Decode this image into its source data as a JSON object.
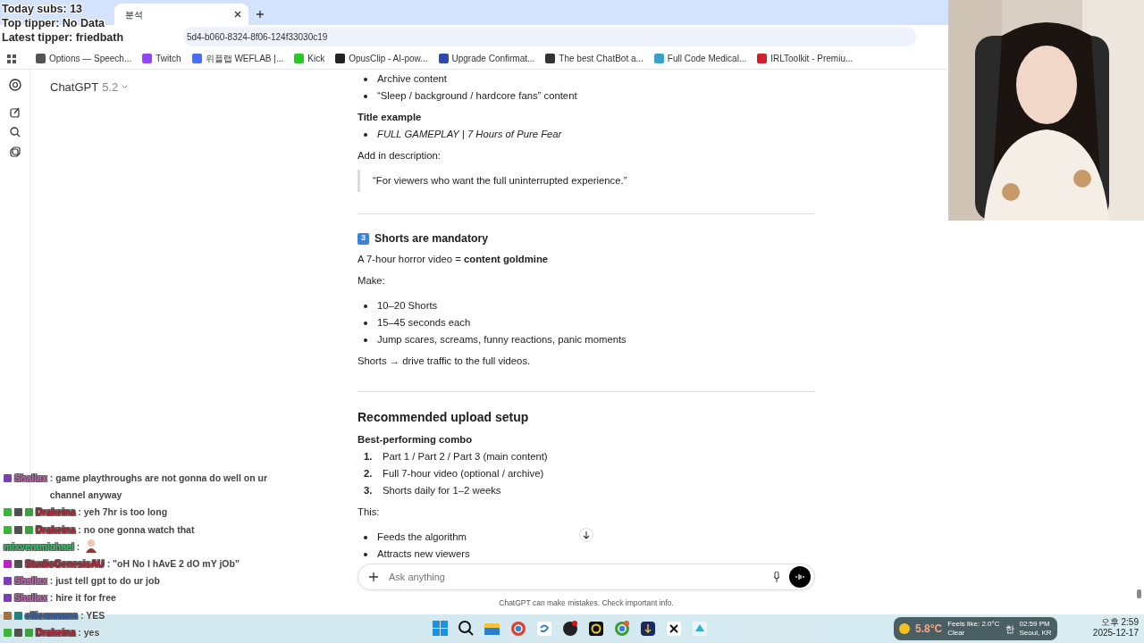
{
  "stream_stats": [
    "Today subs: 13",
    "Top tipper: No Data",
    "Latest tipper: friedbath"
  ],
  "browser": {
    "tab": {
      "title": "분석"
    },
    "url": "5d4-b060-8324-8f06-124f33030c19",
    "bookmarks": [
      {
        "label": "Options — Speech...",
        "color": "#555555"
      },
      {
        "label": "Twitch",
        "color": "#9146ff"
      },
      {
        "label": "위플랩 WEFLAB |...",
        "color": "#4a6cf7"
      },
      {
        "label": "Kick",
        "color": "#28c828"
      },
      {
        "label": "OpusClip - AI-pow...",
        "color": "#222222"
      },
      {
        "label": "Upgrade Confirmat...",
        "color": "#2a4ab0"
      },
      {
        "label": "The best ChatBot a...",
        "color": "#333333"
      },
      {
        "label": "Full Code Medical...",
        "color": "#3aa0c8"
      },
      {
        "label": "IRLToolkit - Premiu...",
        "color": "#d0202a"
      }
    ]
  },
  "header": {
    "model": "ChatGPT",
    "version": "5.2"
  },
  "content": [
    {
      "kind": "bullets",
      "items": [
        "Archive content",
        "“Sleep / background / hardcore fans” content"
      ]
    },
    {
      "kind": "label",
      "text": "Title example"
    },
    {
      "kind": "bullets",
      "italic": true,
      "items": [
        "FULL GAMEPLAY | 7 Hours of Pure Fear"
      ]
    },
    {
      "kind": "text",
      "text": "Add in description:"
    },
    {
      "kind": "quote",
      "text": "“For viewers who want the full uninterrupted experience.”"
    },
    {
      "kind": "divider"
    },
    {
      "kind": "heading3",
      "number": "3",
      "text": "Shorts are mandatory"
    },
    {
      "kind": "text",
      "text": "A 7-hour horror video = **content goldmine**"
    },
    {
      "kind": "text",
      "text": "Make:"
    },
    {
      "kind": "bullets",
      "items": [
        "10–20 Shorts",
        "15–45 seconds each",
        "Jump scares, screams, funny reactions, panic moments"
      ]
    },
    {
      "kind": "text",
      "text": "Shorts → drive traffic to the full videos."
    },
    {
      "kind": "divider"
    },
    {
      "kind": "heading2",
      "text": "Recommended upload setup"
    },
    {
      "kind": "label",
      "text": "Best-performing combo"
    },
    {
      "kind": "numbered",
      "items": [
        {
          "number": "1.",
          "text": "Part 1 / Part 2 / Part 3 (main content)"
        },
        {
          "number": "2.",
          "text": "Full 7-hour video (optional / archive)"
        },
        {
          "number": "3.",
          "text": "Shorts daily for 1–2 weeks"
        }
      ]
    },
    {
      "kind": "text",
      "text": "This:"
    },
    {
      "kind": "bullets",
      "items": [
        "Feeds the algorithm",
        "Attracts new viewers"
      ]
    }
  ],
  "composer": {
    "placeholder": "Ask anything"
  },
  "disclaimer": "ChatGPT can make mistakes. Check important info.",
  "chat": [
    {
      "user": "Shallax",
      "color": "#c060b0",
      "badges": [
        {
          "color": "#7a3fb0"
        }
      ],
      "text": ": game playthroughs are not gonna do well on ur channel anyway"
    },
    {
      "user": "Drakeina",
      "color": "#c0182a",
      "badges": [
        {
          "color": "#3cb43c"
        },
        {
          "color": "#505050"
        },
        {
          "color": "#40a040"
        }
      ],
      "text": ": yeh 7hr is too long"
    },
    {
      "user": "Drakeina",
      "color": "#c0182a",
      "badges": [
        {
          "color": "#3cb43c"
        },
        {
          "color": "#505050"
        },
        {
          "color": "#40a040"
        }
      ],
      "text": ": no one gonna watch that"
    },
    {
      "user": "mixveramichael",
      "color": "#30c060",
      "text": ":",
      "emote": true
    },
    {
      "user": "StudioGenesisAU",
      "color": "#c0182a",
      "badges": [
        {
          "color": "#c020c0"
        },
        {
          "color": "#505050"
        }
      ],
      "text": ": \"oH No I hAvE 2 dO mY jOb\""
    },
    {
      "user": "Shallax",
      "color": "#c060b0",
      "badges": [
        {
          "color": "#7a3fb0"
        }
      ],
      "text": ": just tell gpt to do ur job"
    },
    {
      "user": "Shallax",
      "color": "#c060b0",
      "badges": [
        {
          "color": "#7a3fb0"
        }
      ],
      "text": ": hire it for free"
    },
    {
      "user": "elliennnnnn",
      "color": "#2060c0",
      "badges": [
        {
          "color": "#a07040"
        },
        {
          "color": "#208080"
        }
      ],
      "text": ": YES"
    },
    {
      "user": "Drakeina",
      "color": "#c0182a",
      "badges": [
        {
          "color": "#3cb43c"
        },
        {
          "color": "#505050"
        },
        {
          "color": "#40a040"
        }
      ],
      "text": ": yes"
    }
  ],
  "taskbar": {
    "weather": {
      "temp": "5.8°C",
      "feels": "Feels like: 2.0°C",
      "condition": "Clear",
      "time": "02:59 PM",
      "city": "Seoul, KR"
    },
    "ime": "한",
    "clock_time": "오후 2:59",
    "clock_date": "2025-12-17"
  }
}
